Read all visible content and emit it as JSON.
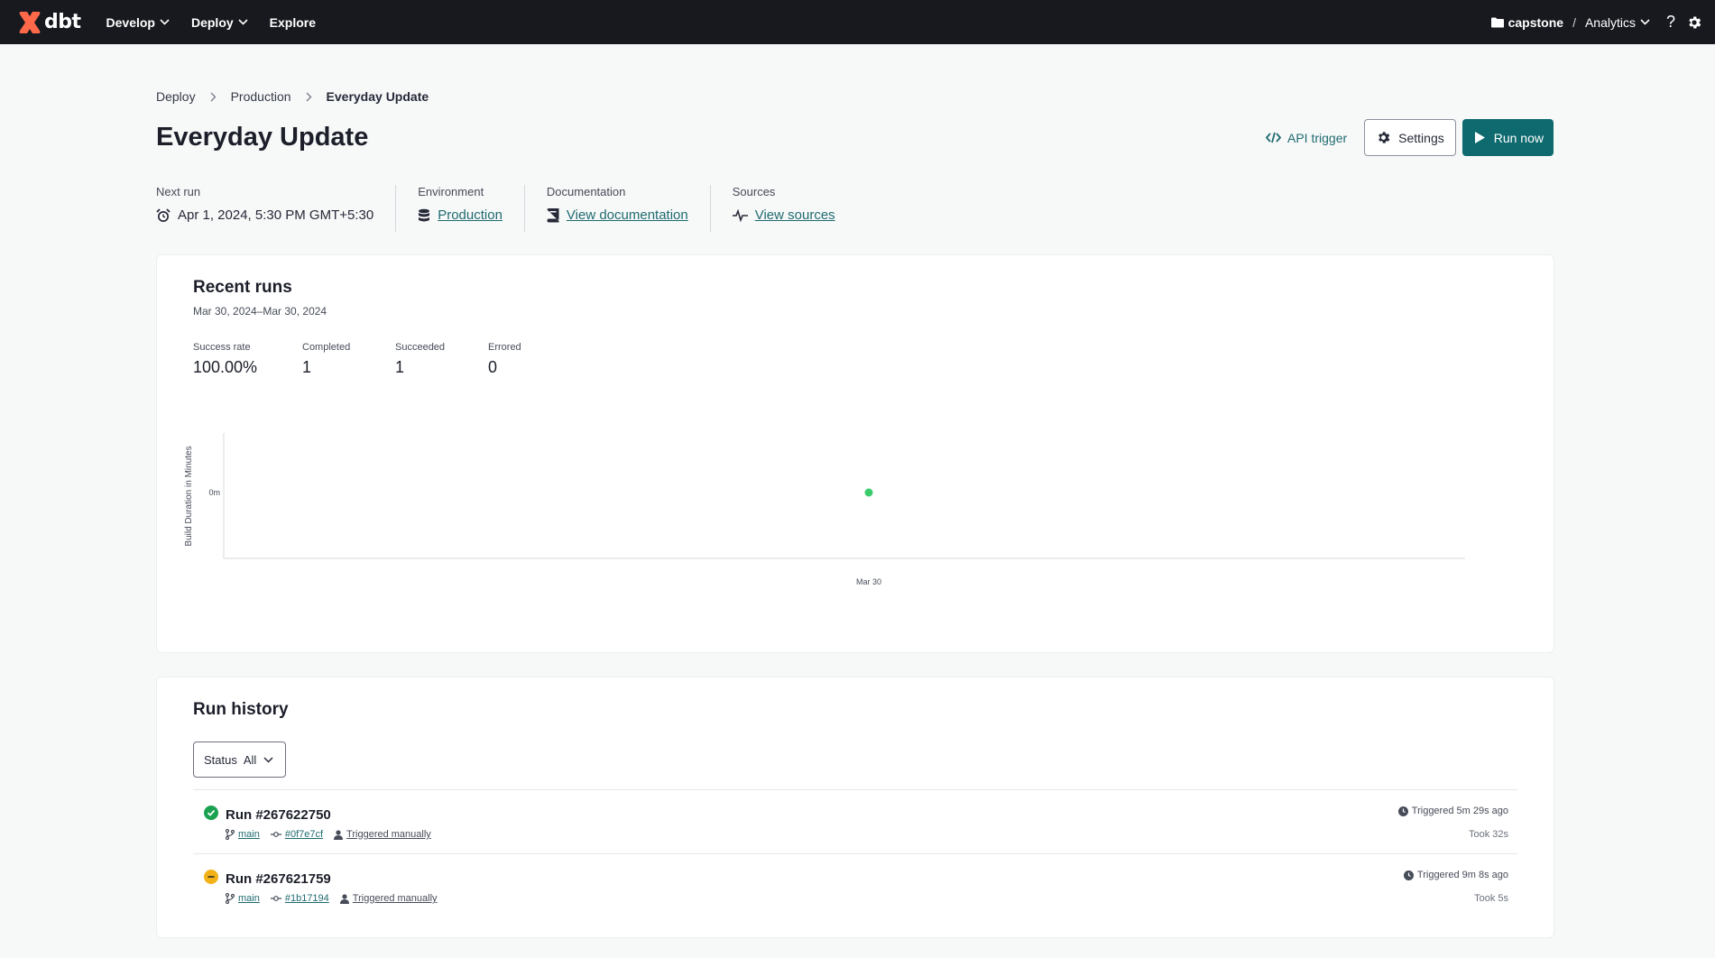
{
  "nav": {
    "logo_text": "dbt",
    "menu": [
      {
        "label": "Develop"
      },
      {
        "label": "Deploy"
      },
      {
        "label": "Explore"
      }
    ],
    "project": "capstone",
    "separator": "/",
    "environment": "Analytics",
    "help": "?"
  },
  "breadcrumb": [
    "Deploy",
    "Production",
    "Everyday Update"
  ],
  "page_title": "Everyday Update",
  "actions": {
    "api_trigger": "API trigger",
    "settings": "Settings",
    "run_now": "Run now"
  },
  "meta": {
    "next_run": {
      "label": "Next run",
      "value": "Apr 1, 2024, 5:30 PM GMT+5:30"
    },
    "environment": {
      "label": "Environment",
      "value": "Production"
    },
    "documentation": {
      "label": "Documentation",
      "value": "View documentation"
    },
    "sources": {
      "label": "Sources",
      "value": "View sources"
    }
  },
  "recent_runs": {
    "title": "Recent runs",
    "date_range": "Mar 30, 2024–Mar 30, 2024",
    "stats": [
      {
        "label": "Success rate",
        "value": "100.00%"
      },
      {
        "label": "Completed",
        "value": "1"
      },
      {
        "label": "Succeeded",
        "value": "1"
      },
      {
        "label": "Errored",
        "value": "0"
      }
    ]
  },
  "chart_data": {
    "type": "scatter",
    "ylabel": "Build Duration in Minutes",
    "xlabel": "",
    "y_tick_labels": [
      "0m"
    ],
    "x_tick_labels": [
      "Mar 30"
    ],
    "points": [
      {
        "x": "Mar 30",
        "y": 0,
        "color": "#3ccb6c"
      }
    ]
  },
  "run_history": {
    "title": "Run history",
    "filter": {
      "label": "Status",
      "value": "All"
    },
    "runs": [
      {
        "name": "Run #267622750",
        "status": "success",
        "status_color": "#1aa251",
        "branch": "main",
        "commit": "#0f7e7cf",
        "trigger": "Triggered manually",
        "triggered_ago": "Triggered 5m 29s ago",
        "took": "Took 32s"
      },
      {
        "name": "Run #267621759",
        "status": "cancelled",
        "status_color": "#f2b217",
        "branch": "main",
        "commit": "#1b17194",
        "trigger": "Triggered manually",
        "triggered_ago": "Triggered 9m 8s ago",
        "took": "Took 5s"
      }
    ]
  },
  "colors": {
    "brand": "#ff694a",
    "primary": "#0e6a6f",
    "nav_bg": "#17191f"
  }
}
